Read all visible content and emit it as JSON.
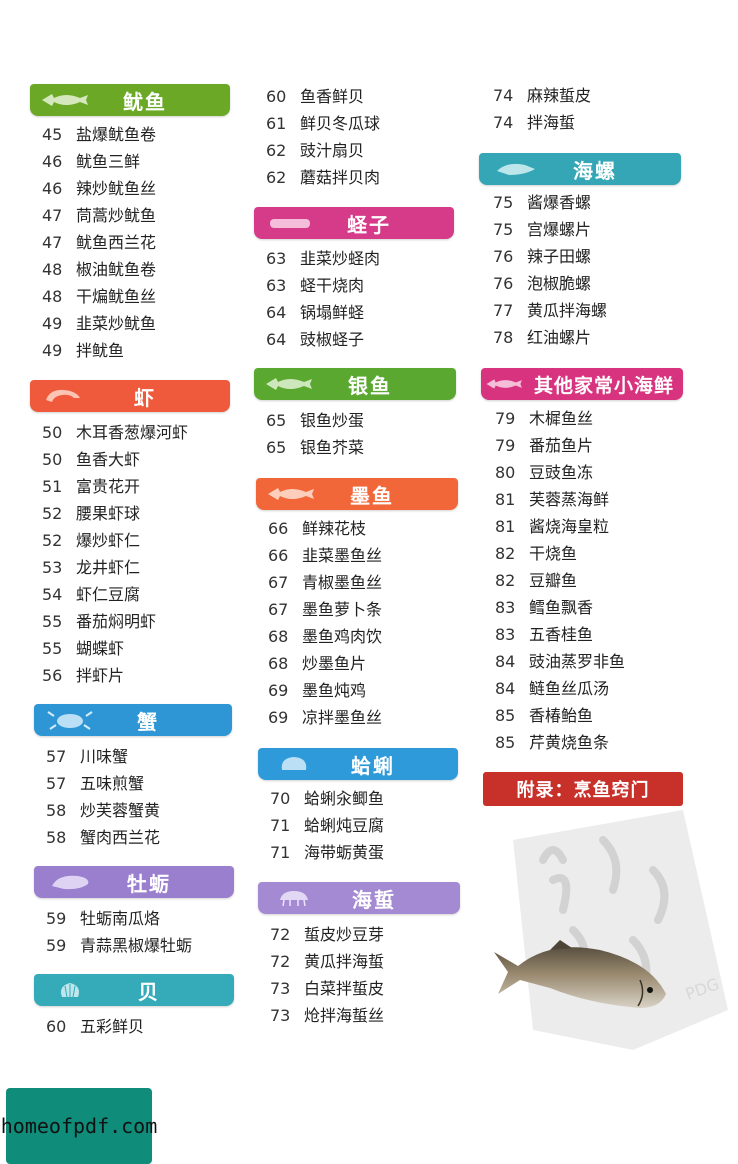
{
  "sections": [
    {
      "id": "squid",
      "title": "鱿鱼",
      "color": "#6aa826",
      "icon": "fish-icon",
      "entries": [
        {
          "page": "45",
          "name": "盐爆鱿鱼卷"
        },
        {
          "page": "46",
          "name": "鱿鱼三鲜"
        },
        {
          "page": "46",
          "name": "辣炒鱿鱼丝"
        },
        {
          "page": "47",
          "name": "茼蒿炒鱿鱼"
        },
        {
          "page": "47",
          "name": "鱿鱼西兰花"
        },
        {
          "page": "48",
          "name": "椒油鱿鱼卷"
        },
        {
          "page": "48",
          "name": "干煸鱿鱼丝"
        },
        {
          "page": "49",
          "name": "韭菜炒鱿鱼"
        },
        {
          "page": "49",
          "name": "拌鱿鱼"
        }
      ]
    },
    {
      "id": "shrimp",
      "title": "虾",
      "color": "#f05a3c",
      "icon": "shrimp-icon",
      "entries": [
        {
          "page": "50",
          "name": "木耳香葱爆河虾"
        },
        {
          "page": "50",
          "name": "鱼香大虾"
        },
        {
          "page": "51",
          "name": "富贵花开"
        },
        {
          "page": "52",
          "name": "腰果虾球"
        },
        {
          "page": "52",
          "name": "爆炒虾仁"
        },
        {
          "page": "53",
          "name": "龙井虾仁"
        },
        {
          "page": "54",
          "name": "虾仁豆腐"
        },
        {
          "page": "55",
          "name": "番茄焖明虾"
        },
        {
          "page": "55",
          "name": "蝴蝶虾"
        },
        {
          "page": "56",
          "name": "拌虾片"
        }
      ]
    },
    {
      "id": "crab",
      "title": "蟹",
      "color": "#2f96d6",
      "icon": "crab-icon",
      "entries": [
        {
          "page": "57",
          "name": "川味蟹"
        },
        {
          "page": "57",
          "name": "五味煎蟹"
        },
        {
          "page": "58",
          "name": "炒芙蓉蟹黄"
        },
        {
          "page": "58",
          "name": "蟹肉西兰花"
        }
      ]
    },
    {
      "id": "oyster",
      "title": "牡蛎",
      "color": "#9b7fcf",
      "icon": "oyster-icon",
      "entries": [
        {
          "page": "59",
          "name": "牡蛎南瓜烙"
        },
        {
          "page": "59",
          "name": "青蒜黑椒爆牡蛎"
        }
      ]
    },
    {
      "id": "shellfish",
      "title": "贝",
      "color": "#35aab8",
      "icon": "scallop-icon",
      "entries": [
        {
          "page": "60",
          "name": "五彩鲜贝"
        },
        {
          "page": "60",
          "name": "鱼香鲜贝"
        },
        {
          "page": "61",
          "name": "鲜贝冬瓜球"
        },
        {
          "page": "62",
          "name": "豉汁扇贝"
        },
        {
          "page": "62",
          "name": "蘑菇拌贝肉"
        }
      ]
    },
    {
      "id": "razor",
      "title": "蛏子",
      "color": "#d63b8a",
      "icon": "razor-clam-icon",
      "entries": [
        {
          "page": "63",
          "name": "韭菜炒蛏肉"
        },
        {
          "page": "63",
          "name": "蛏干烧肉"
        },
        {
          "page": "64",
          "name": "锅塌鲜蛏"
        },
        {
          "page": "64",
          "name": "豉椒蛏子"
        }
      ]
    },
    {
      "id": "silverfish",
      "title": "银鱼",
      "color": "#5aa830",
      "icon": "fish-icon",
      "entries": [
        {
          "page": "65",
          "name": "银鱼炒蛋"
        },
        {
          "page": "65",
          "name": "银鱼芥菜"
        }
      ]
    },
    {
      "id": "cuttlefish",
      "title": "墨鱼",
      "color": "#f2673a",
      "icon": "fish-icon",
      "entries": [
        {
          "page": "66",
          "name": "鲜辣花枝"
        },
        {
          "page": "66",
          "name": "韭菜墨鱼丝"
        },
        {
          "page": "67",
          "name": "青椒墨鱼丝"
        },
        {
          "page": "67",
          "name": "墨鱼萝卜条"
        },
        {
          "page": "68",
          "name": "墨鱼鸡肉饮"
        },
        {
          "page": "68",
          "name": "炒墨鱼片"
        },
        {
          "page": "69",
          "name": "墨鱼炖鸡"
        },
        {
          "page": "69",
          "name": "凉拌墨鱼丝"
        }
      ]
    },
    {
      "id": "clam",
      "title": "蛤蜊",
      "color": "#2f9ad9",
      "icon": "clam-icon",
      "entries": [
        {
          "page": "70",
          "name": "蛤蜊汆鲫鱼"
        },
        {
          "page": "71",
          "name": "蛤蜊炖豆腐"
        },
        {
          "page": "71",
          "name": "海带蛎黄蛋"
        }
      ]
    },
    {
      "id": "jellyfish",
      "title": "海蜇",
      "color": "#a48ad2",
      "icon": "jellyfish-icon",
      "entries": [
        {
          "page": "72",
          "name": "蜇皮炒豆芽"
        },
        {
          "page": "72",
          "name": "黄瓜拌海蜇"
        },
        {
          "page": "73",
          "name": "白菜拌蜇皮"
        },
        {
          "page": "73",
          "name": "炝拌海蜇丝"
        },
        {
          "page": "74",
          "name": "麻辣蜇皮"
        },
        {
          "page": "74",
          "name": "拌海蜇"
        }
      ]
    },
    {
      "id": "whelk",
      "title": "海螺",
      "color": "#34a6b6",
      "icon": "conch-icon",
      "entries": [
        {
          "page": "75",
          "name": "酱爆香螺"
        },
        {
          "page": "75",
          "name": "宫爆螺片"
        },
        {
          "page": "76",
          "name": "辣子田螺"
        },
        {
          "page": "76",
          "name": "泡椒脆螺"
        },
        {
          "page": "77",
          "name": "黄瓜拌海螺"
        },
        {
          "page": "78",
          "name": "红油螺片"
        }
      ]
    },
    {
      "id": "other",
      "title": "其他家常小海鲜",
      "color": "#d8337f",
      "icon": "fish-icon",
      "entries": [
        {
          "page": "79",
          "name": "木樨鱼丝"
        },
        {
          "page": "79",
          "name": "番茄鱼片"
        },
        {
          "page": "80",
          "name": "豆豉鱼冻"
        },
        {
          "page": "81",
          "name": "芙蓉蒸海鲜"
        },
        {
          "page": "81",
          "name": "酱烧海皇粒"
        },
        {
          "page": "82",
          "name": "干烧鱼"
        },
        {
          "page": "82",
          "name": "豆瓣鱼"
        },
        {
          "page": "83",
          "name": "鳕鱼飘香"
        },
        {
          "page": "83",
          "name": "五香桂鱼"
        },
        {
          "page": "84",
          "name": "豉油蒸罗非鱼"
        },
        {
          "page": "84",
          "name": "鲢鱼丝瓜汤"
        },
        {
          "page": "85",
          "name": "香椿鲐鱼"
        },
        {
          "page": "85",
          "name": "芹黄烧鱼条"
        }
      ]
    }
  ],
  "appendix": {
    "title": "附录：烹鱼窍门",
    "color": "#c8302a"
  },
  "watermark": {
    "text": "homeofpdf.com",
    "color": "#0f8c7a"
  },
  "stamp": {
    "text": "PDG"
  }
}
